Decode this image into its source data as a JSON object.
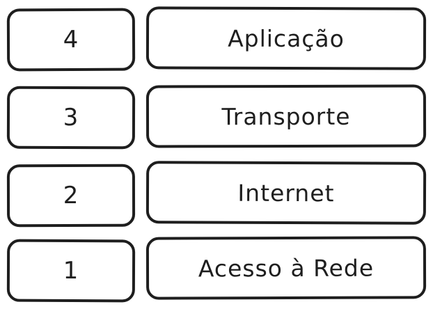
{
  "layers": [
    {
      "number": "4",
      "name": "Aplicação"
    },
    {
      "number": "3",
      "name": "Transporte"
    },
    {
      "number": "2",
      "name": "Internet"
    },
    {
      "number": "1",
      "name": "Acesso à Rede"
    }
  ],
  "colors": {
    "stroke": "#1e1e1e",
    "fill": "#ffffff",
    "text": "#1e1e1e"
  }
}
